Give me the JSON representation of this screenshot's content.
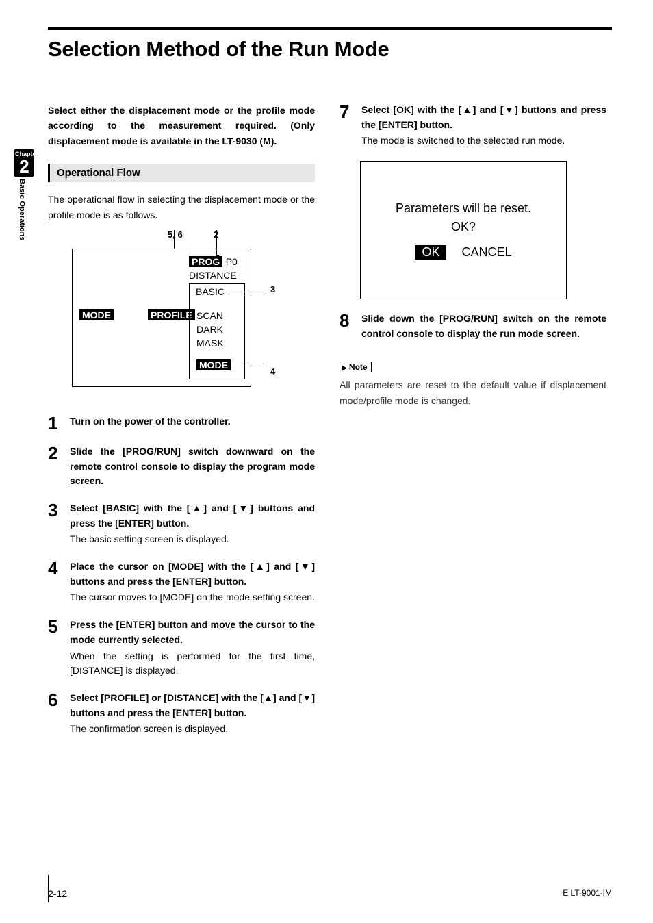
{
  "sidebar": {
    "chapter_label": "Chapter",
    "chapter_num": "2",
    "chapter_name": "Basic Operations"
  },
  "title": "Selection Method of the Run Mode",
  "intro": "Select either the displacement mode or the profile mode according to the measurement required. (Only displacement mode is available in the LT-9030 (M).",
  "opflow": {
    "heading": "Operational Flow",
    "intro": "The operational flow in selecting the displacement mode or the profile mode is as follows.",
    "annot_56": "5, 6",
    "annot_2": "2",
    "annot_3": "3",
    "annot_4": "4",
    "label_prog": "PROG",
    "label_p0": "P0",
    "label_distance": "DISTANCE",
    "label_basic": "BASIC",
    "label_mode": "MODE",
    "label_profile": "PROFILE",
    "label_scan": "SCAN",
    "label_dark": "DARK",
    "label_mask": "MASK",
    "label_mode2": "MODE"
  },
  "steps": [
    {
      "num": "1",
      "bold": "Turn on the power of the controller.",
      "plain": ""
    },
    {
      "num": "2",
      "bold": "Slide the [PROG/RUN] switch downward on the remote control console to display the program mode screen.",
      "plain": ""
    },
    {
      "num": "3",
      "bold": "Select [BASIC] with the [▲] and [▼] buttons and press the [ENTER] button.",
      "plain": "The basic setting screen is displayed."
    },
    {
      "num": "4",
      "bold": "Place the cursor on [MODE] with the [▲] and [▼] buttons and press the [ENTER] button.",
      "plain": "The cursor moves to [MODE] on the mode setting screen."
    },
    {
      "num": "5",
      "bold": "Press the [ENTER] button and move the cursor to the mode currently selected.",
      "plain": "When the setting is performed for the first time, [DISTANCE] is displayed."
    },
    {
      "num": "6",
      "bold": "Select [PROFILE] or [DISTANCE] with the [▲] and [▼] buttons and press the [ENTER] button.",
      "plain": "The confirmation screen is displayed."
    }
  ],
  "steps_r": [
    {
      "num": "7",
      "bold": "Select [OK] with the [▲] and [▼] buttons and press the [ENTER] button.",
      "plain": "The mode is switched to the selected run mode."
    },
    {
      "num": "8",
      "bold": "Slide down the [PROG/RUN] switch on the remote control console to display the run mode screen.",
      "plain": ""
    }
  ],
  "dialog": {
    "msg1": "Parameters will be reset.",
    "msg2": "OK?",
    "ok": "OK",
    "cancel": "CANCEL"
  },
  "note": {
    "tag": "Note",
    "body": "All parameters are reset to the default value if displacement mode/profile mode is changed."
  },
  "footer": {
    "page": "2-12",
    "doc": "E LT-9001-IM"
  }
}
